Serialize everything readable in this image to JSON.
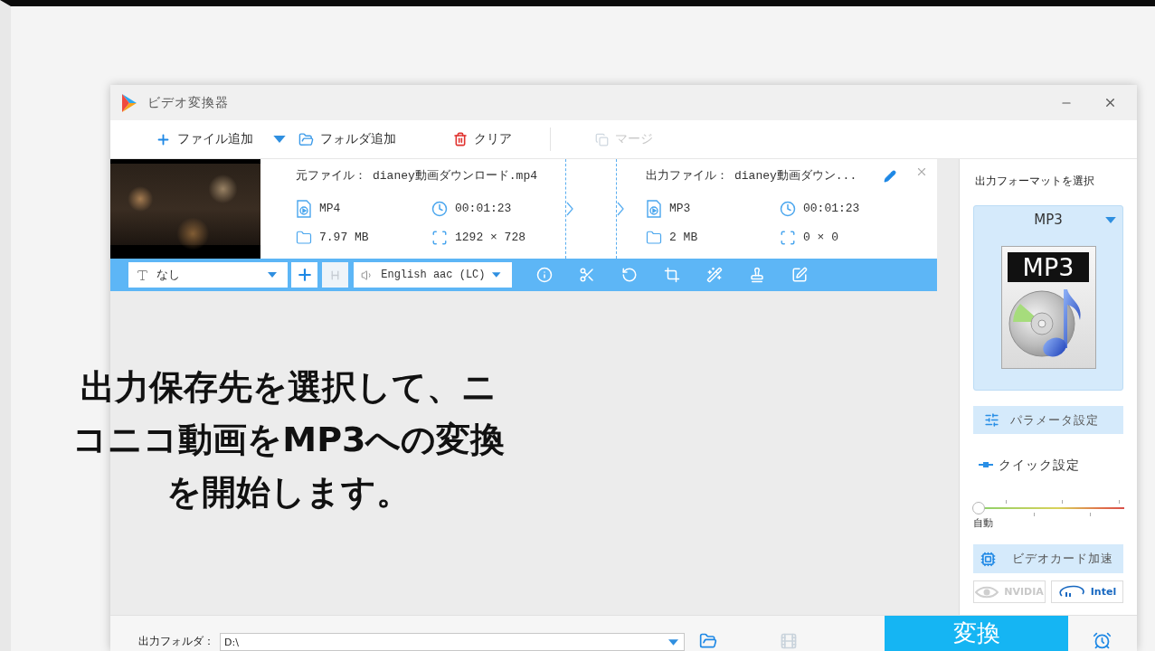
{
  "window": {
    "title": "ビデオ変換器"
  },
  "toolbar": {
    "items": [
      {
        "kind": "add",
        "label": "ファイル追加",
        "has_menu": true,
        "disabled": false
      },
      {
        "kind": "folder",
        "label": "フォルダ追加",
        "has_menu": false,
        "disabled": false
      },
      {
        "kind": "clear",
        "label": "クリア",
        "has_menu": false,
        "disabled": false
      }
    ],
    "merge": {
      "label": "マージ",
      "disabled": true
    }
  },
  "files": [
    {
      "source": {
        "label": "元ファイル：",
        "name": "dianey動画ダウンロード.mp4",
        "format": "MP4",
        "duration": "00:01:23",
        "size": "7.97 MB",
        "resolution": "1292 × 728"
      },
      "output": {
        "label": "出力ファイル：",
        "name": "dianey動画ダウン...",
        "format": "MP3",
        "duration": "00:01:23",
        "size": "2 MB",
        "resolution": "0 × 0"
      },
      "subtitle": "なし",
      "subtitle_style": {
        "disabled": true
      },
      "audio_track": "English aac (LC)"
    }
  ],
  "output_panel": {
    "title": "出力フォーマットを選択",
    "format": {
      "name": "MP3",
      "icon_label": "MP3"
    },
    "parameter_button": {
      "label": "パラメータ設定"
    },
    "quick_settings": {
      "label": "クイック設定",
      "level": 0,
      "reading": "自動"
    },
    "gpu_button": {
      "label": "ビデオカード加速"
    },
    "gpu_options": [
      {
        "kind": "nvidia",
        "label": "NVIDIA",
        "disabled": true
      },
      {
        "kind": "intel",
        "label": "Intel",
        "disabled": false
      }
    ]
  },
  "output_folder": {
    "label": "出力フォルダ：",
    "value": "D:\\"
  },
  "convert_button": {
    "label": "変換"
  },
  "caption": "出力保存先を選択して、ニコニコ動画をMP3への変換を開始します。"
}
